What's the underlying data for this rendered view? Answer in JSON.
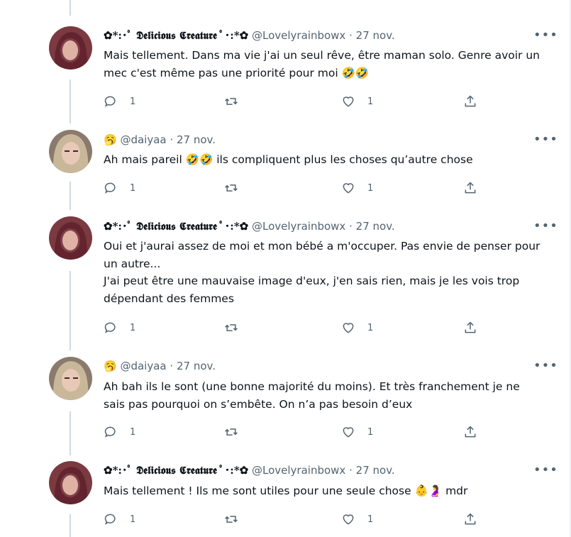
{
  "colors": {
    "text": "#0f1419",
    "muted": "#536471",
    "line": "#cfd9de"
  },
  "tweets": [
    {
      "author": {
        "name": "✿*:･ﾟ 𝕯𝖊𝖑𝖎𝖈𝖎𝖔𝖚𝖘 𝕮𝖗𝖊𝖆𝖙𝖚𝖗𝖊 ﾟ･:*✿",
        "handle": "@Lovelyrainbowx",
        "avatar": "avatar-red-hair"
      },
      "date": "27 nov.",
      "text": "Mais tellement. Dans ma vie j'ai un seul rêve, être maman solo. Genre avoir un mec c'est même pas une priorité pour moi 🤣🤣",
      "replies": "1",
      "likes": "1"
    },
    {
      "author": {
        "name": "🥱",
        "handle": "@daiyaa",
        "avatar": "avatar-blonde"
      },
      "date": "27 nov.",
      "text": "Ah mais pareil 🤣🤣 ils compliquent plus les choses qu’autre chose",
      "replies": "1",
      "likes": "1"
    },
    {
      "author": {
        "name": "✿*:･ﾟ 𝕯𝖊𝖑𝖎𝖈𝖎𝖔𝖚𝖘 𝕮𝖗𝖊𝖆𝖙𝖚𝖗𝖊 ﾟ･:*✿",
        "handle": "@Lovelyrainbowx",
        "avatar": "avatar-red-hair"
      },
      "date": "27 nov.",
      "text1": "Oui et j'aurai assez de moi et mon bébé a m'occuper. Pas envie de penser pour un autre...",
      "text2": "J'ai peut être une mauvaise image d'eux, j'en sais rien, mais je les vois trop dépendant des femmes",
      "replies": "1",
      "likes": "1"
    },
    {
      "author": {
        "name": "🥱",
        "handle": "@daiyaa",
        "avatar": "avatar-blonde"
      },
      "date": "27 nov.",
      "text": "Ah bah ils le sont (une bonne majorité du moins). Et très franchement je ne sais pas pourquoi on s’embête. On n’a pas besoin d’eux",
      "replies": "1",
      "likes": "1"
    },
    {
      "author": {
        "name": "✿*:･ﾟ 𝕯𝖊𝖑𝖎𝖈𝖎𝖔𝖚𝖘 𝕮𝖗𝖊𝖆𝖙𝖚𝖗𝖊 ﾟ･:*✿",
        "handle": "@Lovelyrainbowx",
        "avatar": "avatar-red-hair"
      },
      "date": "27 nov.",
      "text": "Mais tellement ! Ils me sont utiles pour une seule chose 👶🤰 mdr",
      "replies": "1",
      "likes": "1"
    }
  ],
  "dot": "·",
  "more": "•••"
}
